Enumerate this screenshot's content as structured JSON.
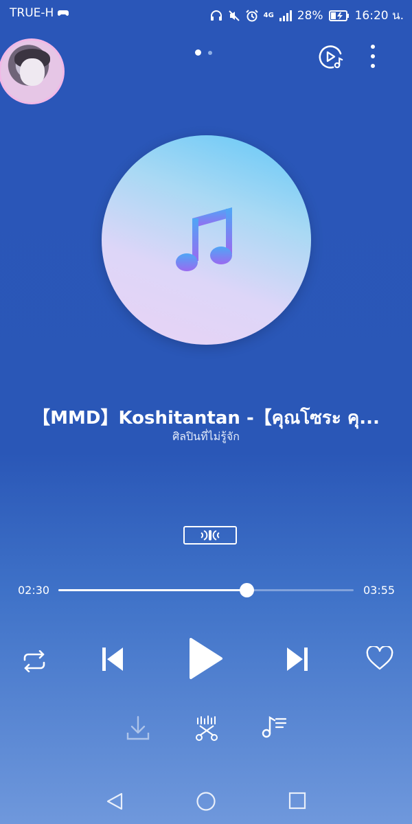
{
  "status_bar": {
    "carrier": "TRUE-H",
    "network": "4G",
    "battery": "28%",
    "time": "16:20 น."
  },
  "header": {
    "page_indicator": {
      "pages": 2,
      "current": 1
    },
    "cast_icon": "cast-music-icon",
    "more_icon": "more-vertical-icon"
  },
  "track": {
    "title": "【MMD】Koshitantan -【คุณโซระ คุ...",
    "artist": "ศิลปินที่ไม่รู้จัก"
  },
  "sound_effect_icon": "sound-effect-icon",
  "progress": {
    "current_time": "02:30",
    "total_time": "03:55",
    "fraction": 0.638
  },
  "controls": {
    "repeat_icon": "repeat-icon",
    "previous_icon": "skip-previous-icon",
    "play_icon": "play-icon",
    "next_icon": "skip-next-icon",
    "favorite_icon": "heart-icon"
  },
  "actions": {
    "download_icon": "download-icon",
    "ringtone_icon": "scissors-cut-icon",
    "playlist_icon": "queue-music-icon"
  },
  "colors": {
    "background_top": "#2a56b8",
    "background_bottom": "#6f98dc",
    "accent": "#ffffff"
  }
}
